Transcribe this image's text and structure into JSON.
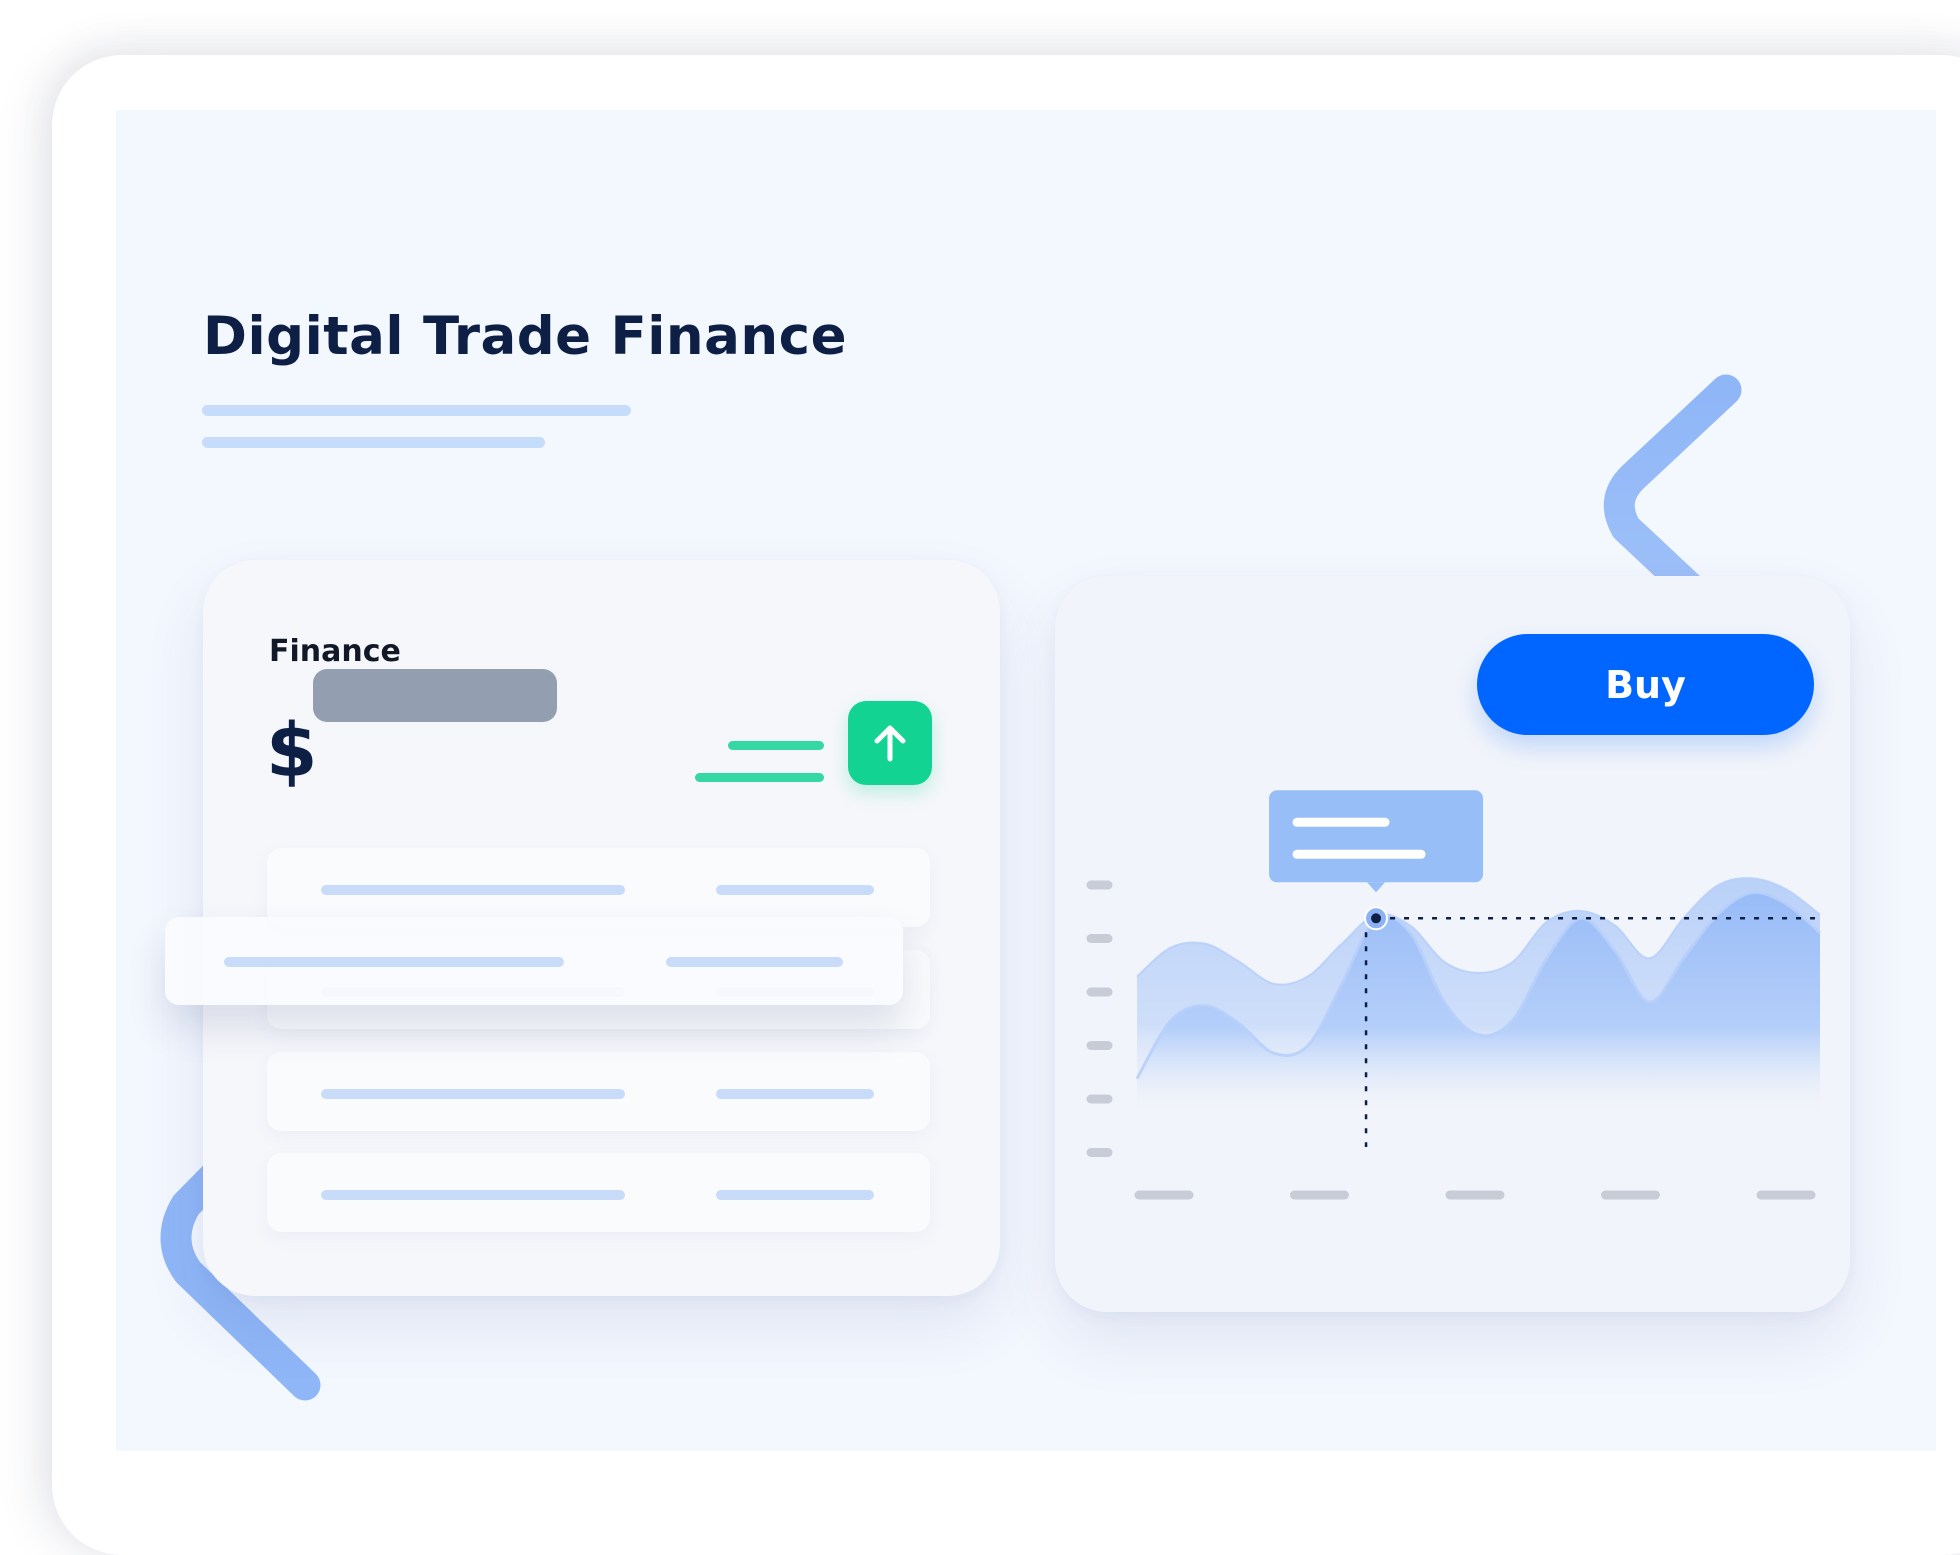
{
  "page": {
    "title": "Digital Trade Finance"
  },
  "finance_card": {
    "label": "Finance",
    "currency_symbol": "$",
    "trend": "up-arrow-icon",
    "rows": 4
  },
  "chart_card": {
    "buy_label": "Buy"
  },
  "colors": {
    "title": "#0e1f45",
    "accent": "#0066ff",
    "positive": "#13d393",
    "placeholder_bar": "#c6dcfb",
    "masked_value": "#939fb1",
    "chart_fill": "#8ab4f8"
  },
  "chart_data": {
    "type": "area",
    "title": "",
    "xlabel": "",
    "ylabel": "",
    "x": [
      0,
      1,
      2,
      3,
      4,
      5,
      6,
      7,
      8,
      9,
      10,
      11,
      12,
      13,
      14,
      15,
      16,
      17,
      18,
      19,
      20
    ],
    "series": [
      {
        "values": [
          3.8,
          4.6,
          4.7,
          4.2,
          3.6,
          3.8,
          4.7,
          5.5,
          5.2,
          4.2,
          3.9,
          4.2,
          5.3,
          5.6,
          5.2,
          4.3,
          5.4,
          6.3,
          6.5,
          6.2,
          5.5
        ]
      },
      {
        "values": [
          1.0,
          2.6,
          3.0,
          2.5,
          1.7,
          1.9,
          3.6,
          5.4,
          5.0,
          3.1,
          2.2,
          2.6,
          4.3,
          5.4,
          4.5,
          3.1,
          4.3,
          5.5,
          6.1,
          5.8,
          5.0
        ]
      }
    ],
    "ylim": [
      0,
      7
    ],
    "highlight_index": 7,
    "y_ticks_count": 6,
    "x_ticks_count": 5,
    "grid": false,
    "legend": "none"
  }
}
